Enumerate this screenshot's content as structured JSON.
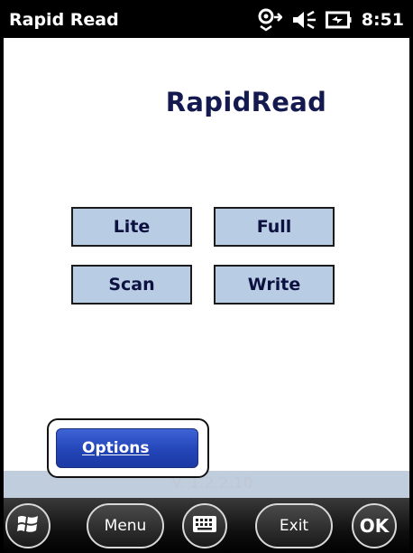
{
  "status_bar": {
    "title": "Rapid Read",
    "time": "8:51",
    "icons": [
      "connectivity-icon",
      "volume-muted-icon",
      "battery-charging-icon"
    ]
  },
  "app": {
    "heading": "RapidRead",
    "buttons": {
      "lite": "Lite",
      "full": "Full",
      "scan": "Scan",
      "write": "Write"
    },
    "version": "V. 1.2.2.10"
  },
  "options_popup": {
    "label": "Options"
  },
  "bottom_bar": {
    "start_icon": "windows-flag-icon",
    "menu": "Menu",
    "keyboard_icon": "keyboard-icon",
    "exit": "Exit",
    "ok": "OK"
  },
  "colors": {
    "status_bar_bg": "#000000",
    "mode_button_bg": "#b8cde4",
    "heading_text": "#141a4f",
    "options_button_bg": "#2345b8",
    "version_strip_bg": "#c0cddd"
  }
}
